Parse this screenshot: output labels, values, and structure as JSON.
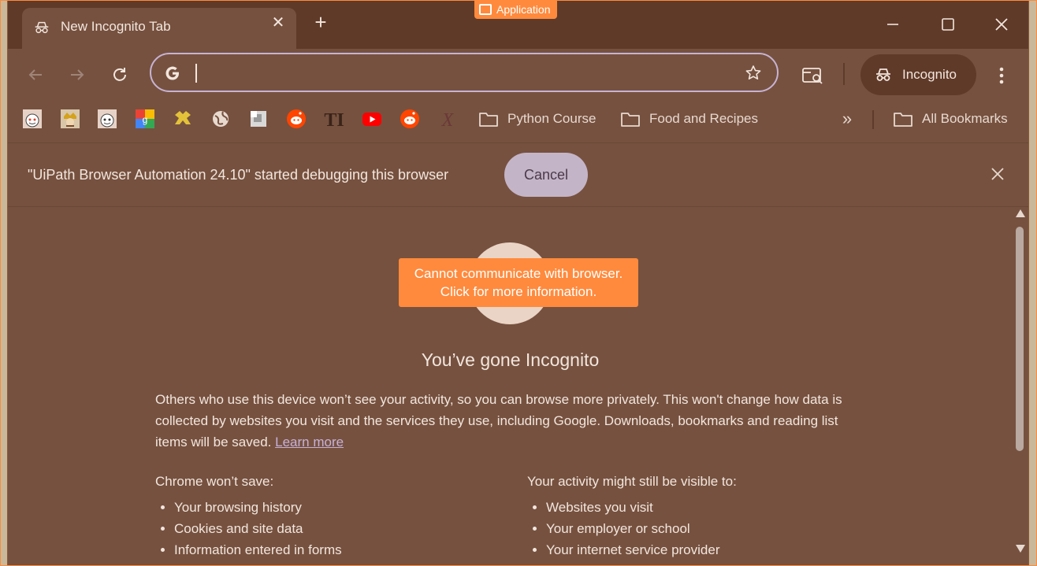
{
  "automation_label": "Application",
  "tab": {
    "title": "New Incognito Tab"
  },
  "omnibox": {
    "value": "",
    "placeholder": ""
  },
  "profile": {
    "label": "Incognito"
  },
  "bookmarks": {
    "folders": [
      "Python Course",
      "Food and Recipes"
    ],
    "all_bookmarks": "All Bookmarks",
    "more_symbol": "»"
  },
  "infobar": {
    "text": "\"UiPath Browser Automation 24.10\" started debugging this browser",
    "cancel": "Cancel"
  },
  "toast": {
    "line1": "Cannot communicate with browser.",
    "line2": "Click for more information."
  },
  "page": {
    "heading": "You’ve gone Incognito",
    "paragraph": "Others who use this device won’t see your activity, so you can browse more privately. This won't change how data is collected by websites you visit and the services they use, including Google. Downloads, bookmarks and reading list items will be saved.",
    "learn_more": "Learn more",
    "left_col": {
      "heading": "Chrome won’t save:",
      "items": [
        "Your browsing history",
        "Cookies and site data",
        "Information entered in forms"
      ]
    },
    "right_col": {
      "heading": "Your activity might still be visible to:",
      "items": [
        "Websites you visit",
        "Your employer or school",
        "Your internet service provider"
      ]
    }
  },
  "colors": {
    "frame": "#603a29",
    "surface": "#76513f",
    "accent": "#ff8a3d",
    "text": "#f2e6dd"
  }
}
